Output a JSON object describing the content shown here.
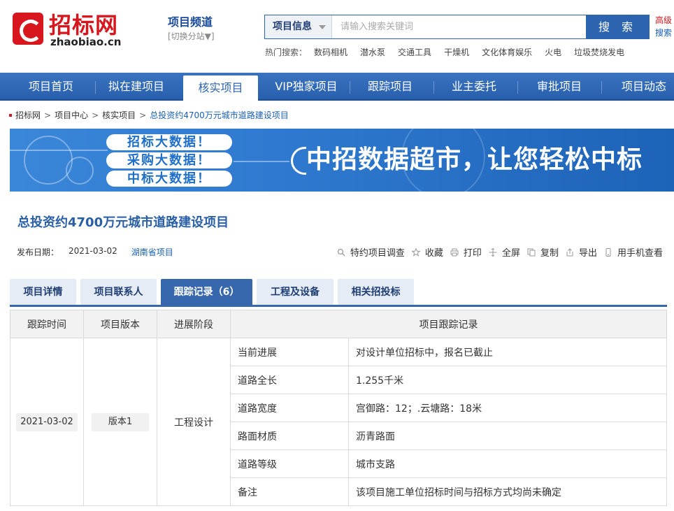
{
  "header": {
    "logo_cn": "招标网",
    "logo_en": "zhaobiao.cn",
    "channel_title": "项目频道",
    "channel_switch": "[切换分站▼]",
    "search": {
      "type_label": "项目信息",
      "placeholder": "请输入搜索关键词",
      "button_label": "搜 索",
      "advanced_label": "高级",
      "advanced_sub": "搜索"
    },
    "hot": {
      "label": "热门搜索：",
      "items": [
        "数码相机",
        "潜水泵",
        "交通工具",
        "干燥机",
        "文化体育娱乐",
        "火电",
        "垃圾焚烧发电"
      ]
    }
  },
  "nav": {
    "items": [
      "项目首页",
      "拟在建项目",
      "核实项目",
      "VIP独家项目",
      "跟踪项目",
      "业主委托",
      "审批项目",
      "项目动态"
    ],
    "active": "核实项目"
  },
  "breadcrumb": [
    "招标网",
    "项目中心",
    "核实项目",
    "总投资约4700万元城市道路建设项目"
  ],
  "banner": {
    "pills": [
      "招标大数据！",
      "采购大数据！",
      "中标大数据！"
    ],
    "slogan": "中招数据超市，让您轻松中标"
  },
  "project": {
    "title": "总投资约4700万元城市道路建设项目",
    "publish_label": "发布日期：",
    "publish_date": "2021-03-02",
    "region": "湖南省项目"
  },
  "actions": [
    "特约项目调查",
    "收藏",
    "打印",
    "全屏",
    "复制",
    "导出",
    "用手机查看"
  ],
  "tabs": {
    "items": [
      "项目详情",
      "项目联系人",
      "跟踪记录（6）",
      "工程及设备",
      "相关招投标"
    ],
    "active_index": 2
  },
  "table": {
    "headers": [
      "跟踪时间",
      "项目版本",
      "进展阶段",
      "项目跟踪记录"
    ],
    "date": "2021-03-02",
    "version": "版本1",
    "stage": "工程设计",
    "records": [
      {
        "key": "当前进展",
        "value": "对设计单位招标中，报名已截止"
      },
      {
        "key": "道路全长",
        "value": "1.255千米"
      },
      {
        "key": "道路宽度",
        "value": "宫御路：12；.云塘路：18米"
      },
      {
        "key": "路面材质",
        "value": "沥青路面"
      },
      {
        "key": "道路等级",
        "value": "城市支路"
      },
      {
        "key": "备注",
        "value": "该项目施工单位招标时间与招标方式均尚未确定"
      }
    ]
  }
}
